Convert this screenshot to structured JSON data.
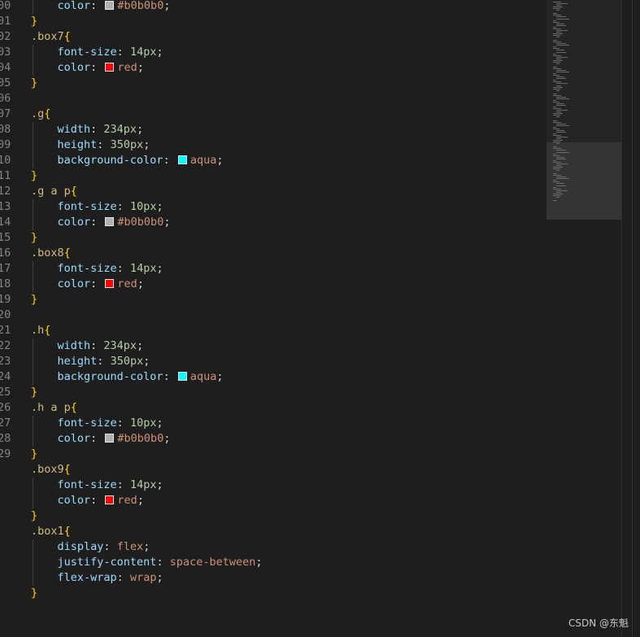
{
  "editor": {
    "line_numbers": [
      "00",
      "01",
      "02",
      "03",
      "04",
      "05",
      "06",
      "07",
      "08",
      "09",
      "10",
      "11",
      "12",
      "13",
      "14",
      "15",
      "16",
      "17",
      "18",
      "19",
      "20",
      "21",
      "22",
      "23",
      "24",
      "25",
      "26",
      "27",
      "28",
      "29"
    ],
    "lines": [
      {
        "tokens": [
          {
            "t": "    ",
            "c": "punc"
          },
          {
            "t": "color",
            "c": "prop"
          },
          {
            "t": ": ",
            "c": "punc"
          },
          {
            "swatch": "#b0b0b0"
          },
          {
            "t": "#b0b0b0",
            "c": "val"
          },
          {
            "t": ";",
            "c": "punc"
          }
        ]
      },
      {
        "tokens": [
          {
            "t": "}",
            "c": "brace"
          }
        ]
      },
      {
        "tokens": [
          {
            "t": ".box7",
            "c": "sel"
          },
          {
            "t": "{",
            "c": "brace"
          }
        ]
      },
      {
        "tokens": [
          {
            "t": "    ",
            "c": "punc"
          },
          {
            "t": "font-size",
            "c": "prop"
          },
          {
            "t": ": ",
            "c": "punc"
          },
          {
            "t": "14px",
            "c": "num"
          },
          {
            "t": ";",
            "c": "punc"
          }
        ]
      },
      {
        "tokens": [
          {
            "t": "    ",
            "c": "punc"
          },
          {
            "t": "color",
            "c": "prop"
          },
          {
            "t": ": ",
            "c": "punc"
          },
          {
            "swatch": "#ff0000"
          },
          {
            "t": "red",
            "c": "val"
          },
          {
            "t": ";",
            "c": "punc"
          }
        ]
      },
      {
        "tokens": [
          {
            "t": "}",
            "c": "brace"
          }
        ]
      },
      {
        "tokens": []
      },
      {
        "tokens": [
          {
            "t": ".g",
            "c": "sel"
          },
          {
            "t": "{",
            "c": "brace"
          }
        ]
      },
      {
        "tokens": [
          {
            "t": "    ",
            "c": "punc"
          },
          {
            "t": "width",
            "c": "prop"
          },
          {
            "t": ": ",
            "c": "punc"
          },
          {
            "t": "234px",
            "c": "num"
          },
          {
            "t": ";",
            "c": "punc"
          }
        ]
      },
      {
        "tokens": [
          {
            "t": "    ",
            "c": "punc"
          },
          {
            "t": "height",
            "c": "prop"
          },
          {
            "t": ": ",
            "c": "punc"
          },
          {
            "t": "350px",
            "c": "num"
          },
          {
            "t": ";",
            "c": "punc"
          }
        ]
      },
      {
        "tokens": [
          {
            "t": "    ",
            "c": "punc"
          },
          {
            "t": "background-color",
            "c": "prop"
          },
          {
            "t": ": ",
            "c": "punc"
          },
          {
            "swatch": "#00ffff"
          },
          {
            "t": "aqua",
            "c": "val"
          },
          {
            "t": ";",
            "c": "punc"
          }
        ]
      },
      {
        "tokens": [
          {
            "t": "}",
            "c": "brace"
          }
        ]
      },
      {
        "tokens": [
          {
            "t": ".g a p",
            "c": "sel"
          },
          {
            "t": "{",
            "c": "brace"
          }
        ]
      },
      {
        "tokens": [
          {
            "t": "    ",
            "c": "punc"
          },
          {
            "t": "font-size",
            "c": "prop"
          },
          {
            "t": ": ",
            "c": "punc"
          },
          {
            "t": "10px",
            "c": "num"
          },
          {
            "t": ";",
            "c": "punc"
          }
        ]
      },
      {
        "tokens": [
          {
            "t": "    ",
            "c": "punc"
          },
          {
            "t": "color",
            "c": "prop"
          },
          {
            "t": ": ",
            "c": "punc"
          },
          {
            "swatch": "#b0b0b0"
          },
          {
            "t": "#b0b0b0",
            "c": "val"
          },
          {
            "t": ";",
            "c": "punc"
          }
        ]
      },
      {
        "tokens": [
          {
            "t": "}",
            "c": "brace"
          }
        ]
      },
      {
        "tokens": [
          {
            "t": ".box8",
            "c": "sel"
          },
          {
            "t": "{",
            "c": "brace"
          }
        ]
      },
      {
        "tokens": [
          {
            "t": "    ",
            "c": "punc"
          },
          {
            "t": "font-size",
            "c": "prop"
          },
          {
            "t": ": ",
            "c": "punc"
          },
          {
            "t": "14px",
            "c": "num"
          },
          {
            "t": ";",
            "c": "punc"
          }
        ]
      },
      {
        "tokens": [
          {
            "t": "    ",
            "c": "punc"
          },
          {
            "t": "color",
            "c": "prop"
          },
          {
            "t": ": ",
            "c": "punc"
          },
          {
            "swatch": "#ff0000"
          },
          {
            "t": "red",
            "c": "val"
          },
          {
            "t": ";",
            "c": "punc"
          }
        ]
      },
      {
        "tokens": [
          {
            "t": "}",
            "c": "brace"
          }
        ]
      },
      {
        "tokens": []
      },
      {
        "tokens": [
          {
            "t": ".h",
            "c": "sel"
          },
          {
            "t": "{",
            "c": "brace"
          }
        ]
      },
      {
        "tokens": [
          {
            "t": "    ",
            "c": "punc"
          },
          {
            "t": "width",
            "c": "prop"
          },
          {
            "t": ": ",
            "c": "punc"
          },
          {
            "t": "234px",
            "c": "num"
          },
          {
            "t": ";",
            "c": "punc"
          }
        ]
      },
      {
        "tokens": [
          {
            "t": "    ",
            "c": "punc"
          },
          {
            "t": "height",
            "c": "prop"
          },
          {
            "t": ": ",
            "c": "punc"
          },
          {
            "t": "350px",
            "c": "num"
          },
          {
            "t": ";",
            "c": "punc"
          }
        ]
      },
      {
        "tokens": [
          {
            "t": "    ",
            "c": "punc"
          },
          {
            "t": "background-color",
            "c": "prop"
          },
          {
            "t": ": ",
            "c": "punc"
          },
          {
            "swatch": "#00ffff"
          },
          {
            "t": "aqua",
            "c": "val"
          },
          {
            "t": ";",
            "c": "punc"
          }
        ]
      },
      {
        "tokens": [
          {
            "t": "}",
            "c": "brace"
          }
        ]
      },
      {
        "tokens": [
          {
            "t": ".h a p",
            "c": "sel"
          },
          {
            "t": "{",
            "c": "brace"
          }
        ]
      },
      {
        "tokens": [
          {
            "t": "    ",
            "c": "punc"
          },
          {
            "t": "font-size",
            "c": "prop"
          },
          {
            "t": ": ",
            "c": "punc"
          },
          {
            "t": "10px",
            "c": "num"
          },
          {
            "t": ";",
            "c": "punc"
          }
        ]
      },
      {
        "tokens": [
          {
            "t": "    ",
            "c": "punc"
          },
          {
            "t": "color",
            "c": "prop"
          },
          {
            "t": ": ",
            "c": "punc"
          },
          {
            "swatch": "#b0b0b0"
          },
          {
            "t": "#b0b0b0",
            "c": "val"
          },
          {
            "t": ";",
            "c": "punc"
          }
        ]
      },
      {
        "tokens": [
          {
            "t": "}",
            "c": "brace"
          }
        ]
      },
      {
        "tokens": [
          {
            "t": ".box9",
            "c": "sel"
          },
          {
            "t": "{",
            "c": "brace"
          }
        ]
      },
      {
        "tokens": [
          {
            "t": "    ",
            "c": "punc"
          },
          {
            "t": "font-size",
            "c": "prop"
          },
          {
            "t": ": ",
            "c": "punc"
          },
          {
            "t": "14px",
            "c": "num"
          },
          {
            "t": ";",
            "c": "punc"
          }
        ]
      },
      {
        "tokens": [
          {
            "t": "    ",
            "c": "punc"
          },
          {
            "t": "color",
            "c": "prop"
          },
          {
            "t": ": ",
            "c": "punc"
          },
          {
            "swatch": "#ff0000"
          },
          {
            "t": "red",
            "c": "val"
          },
          {
            "t": ";",
            "c": "punc"
          }
        ]
      },
      {
        "tokens": [
          {
            "t": "}",
            "c": "brace"
          }
        ]
      },
      {
        "tokens": [
          {
            "t": ".box1",
            "c": "sel"
          },
          {
            "t": "{",
            "c": "brace"
          }
        ]
      },
      {
        "tokens": [
          {
            "t": "    ",
            "c": "punc"
          },
          {
            "t": "display",
            "c": "prop"
          },
          {
            "t": ": ",
            "c": "punc"
          },
          {
            "t": "flex",
            "c": "val"
          },
          {
            "t": ";",
            "c": "punc"
          }
        ]
      },
      {
        "tokens": [
          {
            "t": "    ",
            "c": "punc"
          },
          {
            "t": "justify-content",
            "c": "prop"
          },
          {
            "t": ": ",
            "c": "punc"
          },
          {
            "t": "space-between",
            "c": "val"
          },
          {
            "t": ";",
            "c": "punc"
          }
        ]
      },
      {
        "tokens": [
          {
            "t": "    ",
            "c": "punc"
          },
          {
            "t": "flex-wrap",
            "c": "prop"
          },
          {
            "t": ": ",
            "c": "punc"
          },
          {
            "t": "wrap",
            "c": "val"
          },
          {
            "t": ";",
            "c": "punc"
          }
        ]
      },
      {
        "tokens": [
          {
            "t": "}",
            "c": "brace"
          }
        ]
      },
      {
        "tokens": []
      }
    ]
  },
  "line_number_map": [
    0,
    1,
    2,
    3,
    4,
    5,
    6,
    7,
    8,
    9,
    10,
    11,
    12,
    13,
    14,
    15,
    16,
    17,
    18,
    19,
    20,
    21,
    22,
    23,
    24,
    25,
    26,
    27,
    28,
    29
  ],
  "watermark": "CSDN @东魁",
  "colors": {
    "background": "#1e1e1e",
    "selector": "#d7ba7d",
    "brace": "#ffd700",
    "property": "#9cdcfe",
    "number": "#b5cea8",
    "value": "#ce9178",
    "line_number": "#858585"
  }
}
